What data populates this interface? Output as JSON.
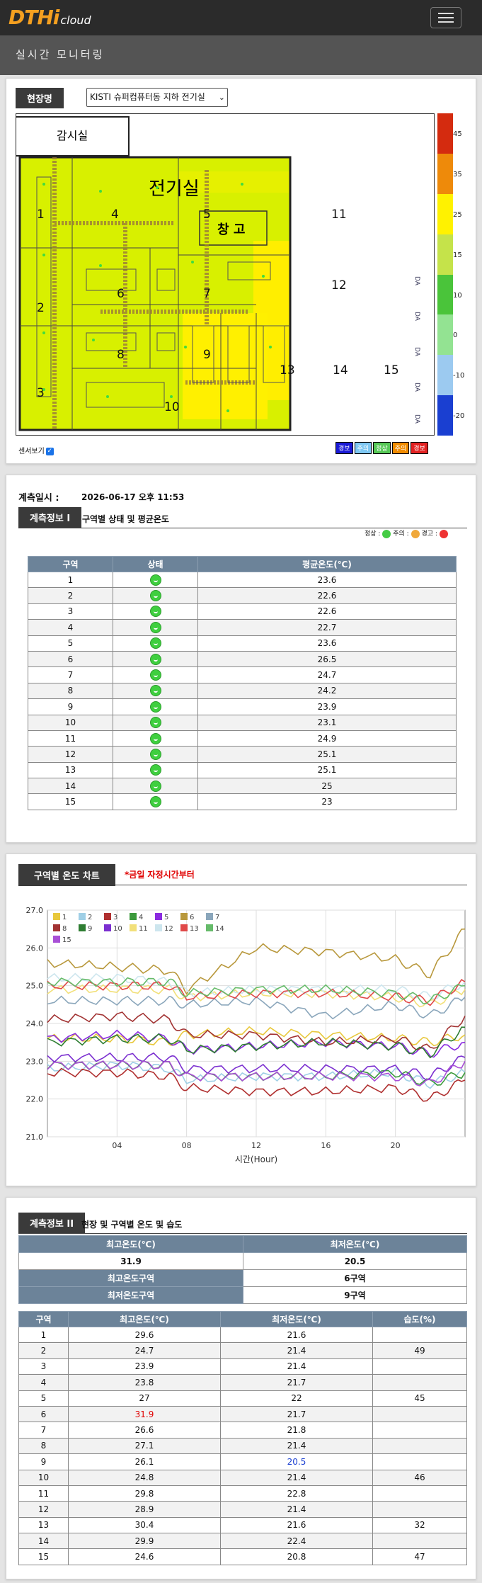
{
  "header": {
    "logo_main": "DTHi",
    "logo_sub": "cloud",
    "subtitle": "실시간 모니터링"
  },
  "site": {
    "label": "현장명",
    "selected": "KISTI 슈퍼컴퓨터동 지하 전기실"
  },
  "floorplan": {
    "rooms": {
      "control": "감시실",
      "electric": "전기실",
      "storage": "창 고"
    },
    "zones": [
      "1",
      "2",
      "3",
      "4",
      "5",
      "6",
      "7",
      "8",
      "9",
      "10",
      "11",
      "12",
      "13",
      "14",
      "15"
    ],
    "da_labels": [
      "DA",
      "DA",
      "DA",
      "DA",
      "DA"
    ]
  },
  "scale": {
    "ticks": [
      "45",
      "35",
      "25",
      "15",
      "10",
      "0",
      "-10",
      "-20"
    ],
    "colors": [
      "#d42b0f",
      "#ee8a0a",
      "#fff200",
      "#c5e34a",
      "#4ac43a",
      "#93e392",
      "#9ccaf0",
      "#1a3fd1"
    ]
  },
  "sensor_toggle": {
    "label": "센서보기",
    "checked": true
  },
  "status_legend": [
    {
      "label": "경보",
      "color": "#1a1ad6"
    },
    {
      "label": "주의",
      "color": "#7ec8f3"
    },
    {
      "label": "정상",
      "color": "#56c856"
    },
    {
      "label": "주의",
      "color": "#f08b00"
    },
    {
      "label": "경보",
      "color": "#e32222"
    }
  ],
  "measure": {
    "label": "계측일시 :",
    "value": "2026-06-17 오후 11:53"
  },
  "info1": {
    "tag": "계측정보 I",
    "desc": "구역별 상태 및 평균온도",
    "key": {
      "normal": "정상 :",
      "caution": "주의 :",
      "warning": "경고 :"
    },
    "headers": [
      "구역",
      "상태",
      "평균온도(℃)"
    ],
    "rows": [
      [
        "1",
        "23.6"
      ],
      [
        "2",
        "22.6"
      ],
      [
        "3",
        "22.6"
      ],
      [
        "4",
        "22.7"
      ],
      [
        "5",
        "23.6"
      ],
      [
        "6",
        "26.5"
      ],
      [
        "7",
        "24.7"
      ],
      [
        "8",
        "24.2"
      ],
      [
        "9",
        "23.9"
      ],
      [
        "10",
        "23.1"
      ],
      [
        "11",
        "24.9"
      ],
      [
        "12",
        "25.1"
      ],
      [
        "13",
        "25.1"
      ],
      [
        "14",
        "25"
      ],
      [
        "15",
        "23"
      ]
    ]
  },
  "chart_section": {
    "tag": "구역별 온도 차트",
    "note": "*금일 자정시간부터"
  },
  "chart_data": {
    "type": "line",
    "xlabel": "시간(Hour)",
    "ylabel": "",
    "xlim": [
      0,
      24
    ],
    "ylim": [
      21.0,
      27.0
    ],
    "xticks": [
      "04",
      "08",
      "12",
      "16",
      "20"
    ],
    "xtick_values": [
      4,
      8,
      12,
      16,
      20
    ],
    "yticks": [
      "21.0",
      "22.0",
      "23.0",
      "24.0",
      "25.0",
      "26.0",
      "27.0"
    ],
    "grid": true,
    "legend": "top-left",
    "series": [
      {
        "name": "1",
        "color": "#e8c83c",
        "values": [
          [
            0,
            23.6
          ],
          [
            4,
            23.6
          ],
          [
            7,
            23.5
          ],
          [
            8,
            23.7
          ],
          [
            12,
            23.8
          ],
          [
            16,
            23.7
          ],
          [
            20,
            23.6
          ],
          [
            22,
            23.5
          ],
          [
            24,
            23.7
          ]
        ]
      },
      {
        "name": "2",
        "color": "#9fcfe6",
        "values": [
          [
            0,
            22.8
          ],
          [
            4,
            22.9
          ],
          [
            7,
            22.8
          ],
          [
            8,
            22.5
          ],
          [
            12,
            22.6
          ],
          [
            16,
            22.6
          ],
          [
            20,
            22.7
          ],
          [
            22,
            22.4
          ],
          [
            24,
            22.7
          ]
        ]
      },
      {
        "name": "3",
        "color": "#b03030",
        "values": [
          [
            0,
            22.7
          ],
          [
            4,
            22.7
          ],
          [
            7,
            22.6
          ],
          [
            8,
            22.3
          ],
          [
            12,
            22.2
          ],
          [
            16,
            22.2
          ],
          [
            20,
            22.3
          ],
          [
            22,
            22.0
          ],
          [
            24,
            22.5
          ]
        ]
      },
      {
        "name": "4",
        "color": "#3c9a3c",
        "values": [
          [
            0,
            22.9
          ],
          [
            4,
            22.9
          ],
          [
            7,
            22.9
          ],
          [
            8,
            22.6
          ],
          [
            12,
            22.6
          ],
          [
            16,
            22.6
          ],
          [
            20,
            22.7
          ],
          [
            22,
            22.4
          ],
          [
            24,
            22.7
          ]
        ]
      },
      {
        "name": "5",
        "color": "#8b2be0",
        "values": [
          [
            0,
            23.6
          ],
          [
            4,
            23.7
          ],
          [
            7,
            23.6
          ],
          [
            8,
            23.3
          ],
          [
            12,
            23.4
          ],
          [
            16,
            23.5
          ],
          [
            20,
            23.4
          ],
          [
            22,
            23.2
          ],
          [
            24,
            23.5
          ]
        ]
      },
      {
        "name": "6",
        "color": "#b8983c",
        "values": [
          [
            0,
            25.6
          ],
          [
            4,
            25.5
          ],
          [
            7,
            25.4
          ],
          [
            8,
            24.9
          ],
          [
            12,
            26.0
          ],
          [
            16,
            25.9
          ],
          [
            20,
            25.7
          ],
          [
            22,
            25.3
          ],
          [
            24,
            26.5
          ]
        ]
      },
      {
        "name": "7",
        "color": "#8aa6bb",
        "values": [
          [
            0,
            24.6
          ],
          [
            4,
            24.6
          ],
          [
            7,
            24.6
          ],
          [
            8,
            24.5
          ],
          [
            12,
            24.6
          ],
          [
            16,
            24.2
          ],
          [
            20,
            24.5
          ],
          [
            22,
            24.2
          ],
          [
            24,
            24.7
          ]
        ]
      },
      {
        "name": "8",
        "color": "#a23333",
        "values": [
          [
            0,
            24.1
          ],
          [
            4,
            24.2
          ],
          [
            7,
            24.1
          ],
          [
            8,
            23.7
          ],
          [
            12,
            23.7
          ],
          [
            16,
            23.5
          ],
          [
            20,
            23.6
          ],
          [
            22,
            23.3
          ],
          [
            24,
            24.2
          ]
        ]
      },
      {
        "name": "9",
        "color": "#2e7d32",
        "values": [
          [
            0,
            23.5
          ],
          [
            4,
            23.6
          ],
          [
            7,
            23.6
          ],
          [
            8,
            23.3
          ],
          [
            12,
            23.4
          ],
          [
            16,
            23.5
          ],
          [
            20,
            23.4
          ],
          [
            22,
            23.2
          ],
          [
            24,
            23.9
          ]
        ]
      },
      {
        "name": "10",
        "color": "#7b2fd0",
        "values": [
          [
            0,
            23.1
          ],
          [
            4,
            23.1
          ],
          [
            7,
            23.1
          ],
          [
            8,
            22.8
          ],
          [
            12,
            22.8
          ],
          [
            16,
            22.8
          ],
          [
            20,
            22.8
          ],
          [
            22,
            22.6
          ],
          [
            24,
            23.1
          ]
        ]
      },
      {
        "name": "11",
        "color": "#f2e07a",
        "values": [
          [
            0,
            24.9
          ],
          [
            4,
            24.9
          ],
          [
            7,
            24.9
          ],
          [
            8,
            24.7
          ],
          [
            12,
            24.8
          ],
          [
            16,
            24.8
          ],
          [
            20,
            24.7
          ],
          [
            22,
            24.5
          ],
          [
            24,
            24.9
          ]
        ]
      },
      {
        "name": "12",
        "color": "#cde6ee",
        "values": [
          [
            0,
            25.2
          ],
          [
            4,
            25.2
          ],
          [
            7,
            25.1
          ],
          [
            8,
            24.8
          ],
          [
            12,
            24.9
          ],
          [
            16,
            24.9
          ],
          [
            20,
            24.9
          ],
          [
            22,
            24.7
          ],
          [
            24,
            25.1
          ]
        ]
      },
      {
        "name": "13",
        "color": "#e04848",
        "values": [
          [
            0,
            25.0
          ],
          [
            4,
            25.0
          ],
          [
            7,
            25.0
          ],
          [
            8,
            24.7
          ],
          [
            12,
            24.8
          ],
          [
            16,
            24.8
          ],
          [
            20,
            24.7
          ],
          [
            22,
            24.6
          ],
          [
            24,
            25.1
          ]
        ]
      },
      {
        "name": "14",
        "color": "#66bb6a",
        "values": [
          [
            0,
            25.1
          ],
          [
            4,
            25.1
          ],
          [
            7,
            25.1
          ],
          [
            8,
            24.8
          ],
          [
            12,
            24.9
          ],
          [
            16,
            24.9
          ],
          [
            20,
            24.8
          ],
          [
            22,
            24.6
          ],
          [
            24,
            25.0
          ]
        ]
      },
      {
        "name": "15",
        "color": "#a84fd6",
        "values": [
          [
            0,
            22.9
          ],
          [
            4,
            22.9
          ],
          [
            7,
            22.9
          ],
          [
            8,
            22.6
          ],
          [
            12,
            22.6
          ],
          [
            16,
            22.6
          ],
          [
            20,
            22.6
          ],
          [
            22,
            22.4
          ],
          [
            24,
            23.0
          ]
        ]
      }
    ]
  },
  "info2": {
    "tag": "계측정보 II",
    "desc": "현장 및 구역별 온도 및 습도",
    "summary": {
      "max_label": "최고온도(℃)",
      "min_label": "최저온도(℃)",
      "max_val": "31.9",
      "min_val": "20.5",
      "max_zone_label": "최고온도구역",
      "max_zone_val": "6구역",
      "min_zone_label": "최저온도구역",
      "min_zone_val": "9구역"
    },
    "headers": [
      "구역",
      "최고온도(℃)",
      "최저온도(℃)",
      "습도(%)"
    ],
    "rows": [
      [
        "1",
        "29.6",
        "21.6",
        ""
      ],
      [
        "2",
        "24.7",
        "21.4",
        "49"
      ],
      [
        "3",
        "23.9",
        "21.4",
        ""
      ],
      [
        "4",
        "23.8",
        "21.7",
        ""
      ],
      [
        "5",
        "27",
        "22",
        "45"
      ],
      [
        "6",
        "31.9",
        "21.7",
        ""
      ],
      [
        "7",
        "26.6",
        "21.8",
        ""
      ],
      [
        "8",
        "27.1",
        "21.4",
        ""
      ],
      [
        "9",
        "26.1",
        "20.5",
        ""
      ],
      [
        "10",
        "24.8",
        "21.4",
        "46"
      ],
      [
        "11",
        "29.8",
        "22.8",
        ""
      ],
      [
        "12",
        "28.9",
        "21.4",
        ""
      ],
      [
        "13",
        "30.4",
        "21.6",
        "32"
      ],
      [
        "14",
        "29.9",
        "22.4",
        ""
      ],
      [
        "15",
        "24.6",
        "20.8",
        "47"
      ]
    ],
    "highlight_max_row": 5,
    "highlight_min_row": 8,
    "max_color": "#e00000",
    "min_color": "#1a3fd1"
  }
}
